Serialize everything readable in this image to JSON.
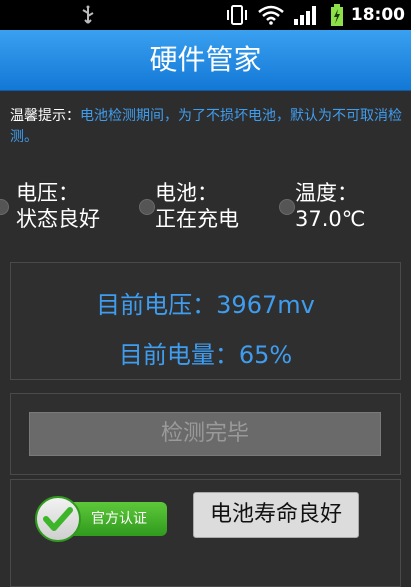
{
  "statusbar": {
    "time": "18:00",
    "icons": [
      "usb-icon",
      "vibrate-icon",
      "wifi-icon",
      "signal-icon",
      "battery-charging-icon"
    ]
  },
  "app": {
    "title": "硬件管家"
  },
  "notice": {
    "label": "温馨提示：",
    "text": "电池检测期间，为了不损坏电池，默认为不可取消检测。"
  },
  "stats": {
    "voltage_label": "电压：",
    "voltage_status": "状态良好",
    "battery_label": "电池：",
    "battery_status": "正在充电",
    "temp_label": "温度：",
    "temp_value": "37.0℃"
  },
  "readings": {
    "current_voltage": "目前电压：3967mv",
    "current_level": "目前电量：65%"
  },
  "buttons": {
    "check_done": "检测完毕",
    "battery_life": "电池寿命良好"
  },
  "badge": {
    "label": "官方认证"
  },
  "colors": {
    "accent": "#3f9df0",
    "titlebar": "#1e88e5",
    "badge_green": "#3db52a"
  }
}
